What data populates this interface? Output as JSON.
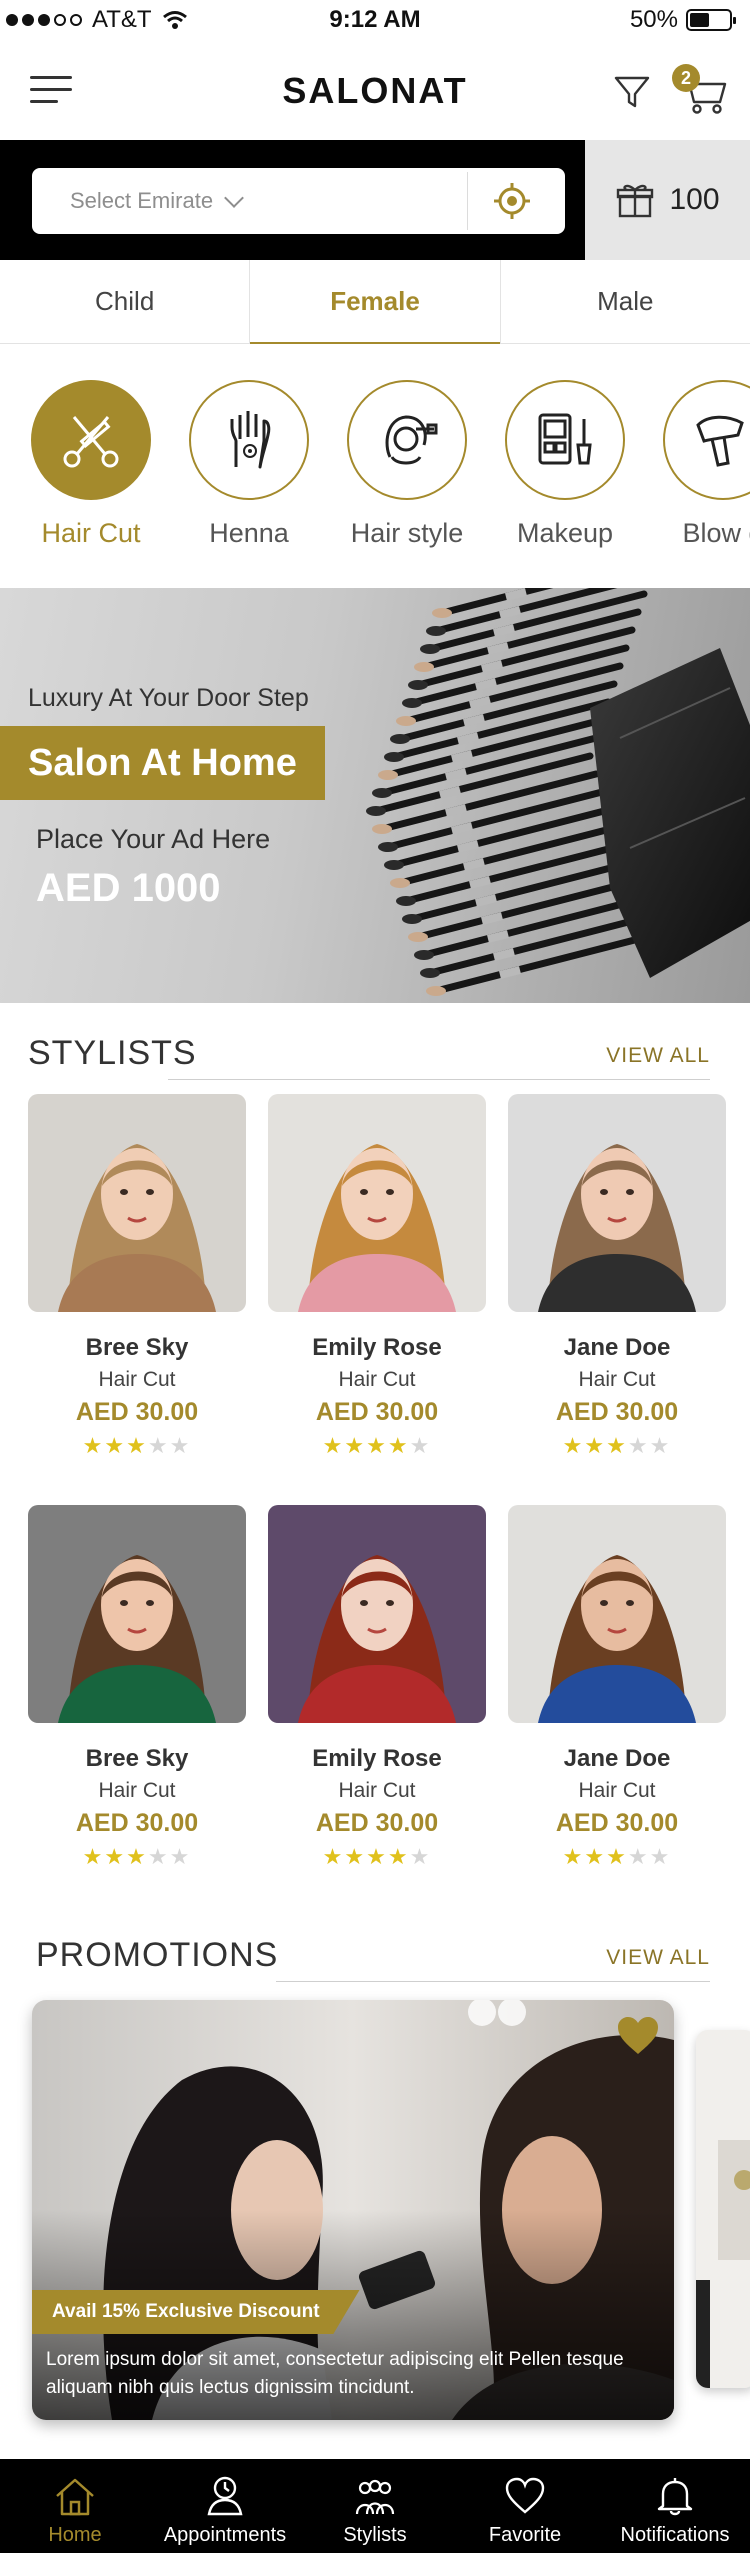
{
  "status_bar": {
    "carrier": "AT&T",
    "time": "9:12 AM",
    "battery": "50%",
    "battery_level": 0.5
  },
  "header": {
    "logo": "SALONAT",
    "cart_count": "2"
  },
  "location": {
    "placeholder": "Select Emirate",
    "points": "100"
  },
  "gender_tabs": [
    {
      "label": "Child",
      "active": false
    },
    {
      "label": "Female",
      "active": true
    },
    {
      "label": "Male",
      "active": false
    }
  ],
  "services": [
    {
      "label": "Hair Cut",
      "icon": "scissors-comb-icon",
      "active": true
    },
    {
      "label": "Henna",
      "icon": "henna-hand-icon",
      "active": false
    },
    {
      "label": "Hair style",
      "icon": "hair-style-icon",
      "active": false
    },
    {
      "label": "Makeup",
      "icon": "makeup-palette-icon",
      "active": false
    },
    {
      "label": "Blow d",
      "icon": "blow-dryer-icon",
      "active": false
    }
  ],
  "banner": {
    "tagline": "Luxury At Your Door Step",
    "title": "Salon At Home",
    "ad_text": "Place Your Ad Here",
    "price": "AED 1000"
  },
  "stylists": {
    "title": "STYLISTS",
    "view_all": "VIEW ALL",
    "items": [
      {
        "name": "Bree Sky",
        "service": "Hair Cut",
        "price": "AED 30.00",
        "rating": 3
      },
      {
        "name": "Emily Rose",
        "service": "Hair Cut",
        "price": "AED 30.00",
        "rating": 4
      },
      {
        "name": "Jane Doe",
        "service": "Hair Cut",
        "price": "AED 30.00",
        "rating": 3
      },
      {
        "name": "Bree Sky",
        "service": "Hair Cut",
        "price": "AED 30.00",
        "rating": 3
      },
      {
        "name": "Emily Rose",
        "service": "Hair Cut",
        "price": "AED 30.00",
        "rating": 4
      },
      {
        "name": "Jane Doe",
        "service": "Hair Cut",
        "price": "AED 30.00",
        "rating": 3
      }
    ]
  },
  "promotions": {
    "title": "PROMOTIONS",
    "view_all": "VIEW ALL",
    "badge": "Avail 15% Exclusive Discount",
    "text": "Lorem ipsum dolor sit amet, consectetur adipiscing elit Pellen tesque aliquam nibh quis lectus dignissim tincidunt."
  },
  "tab_bar": [
    {
      "label": "Home",
      "icon": "home-icon",
      "active": true
    },
    {
      "label": "Appointments",
      "icon": "appointments-icon",
      "active": false
    },
    {
      "label": "Stylists",
      "icon": "stylists-icon",
      "active": false
    },
    {
      "label": "Favorite",
      "icon": "heart-icon",
      "active": false
    },
    {
      "label": "Notifications",
      "icon": "bell-icon",
      "active": false
    }
  ],
  "colors": {
    "accent": "#a48a2c",
    "dark": "#000000",
    "star": "#e0c11c"
  }
}
